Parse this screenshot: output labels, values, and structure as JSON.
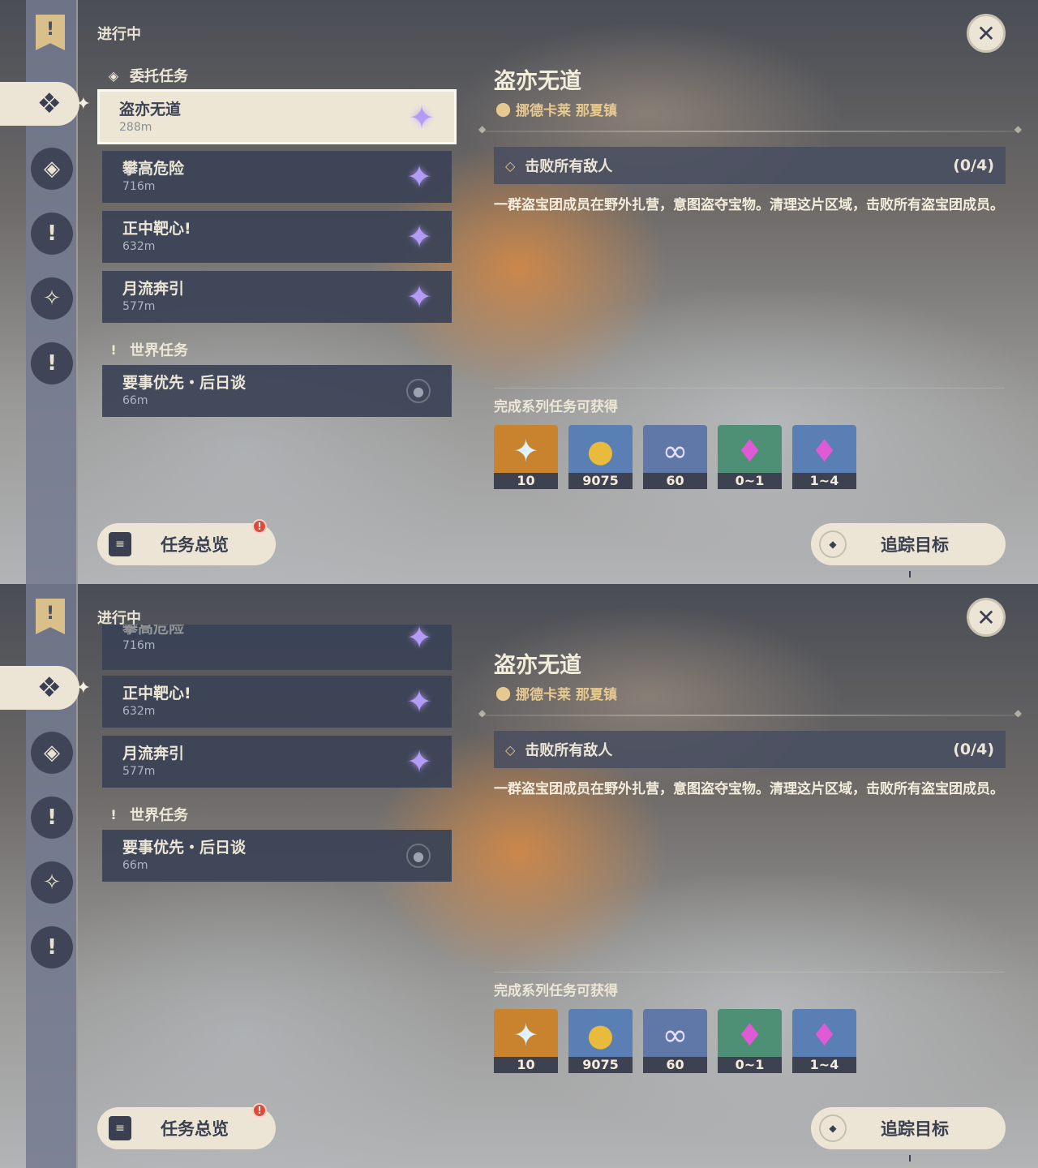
{
  "rail": {
    "banner_icon": "quest-banner-icon",
    "icons": [
      "commission-icon",
      "archon-icon",
      "story-icon",
      "world-icon",
      "exclamation-icon"
    ]
  },
  "list": {
    "status_label": "进行中",
    "sections": [
      {
        "title": "委托任务",
        "quests": [
          {
            "name": "盗亦无道",
            "distance": "288m"
          },
          {
            "name": "攀高危险",
            "distance": "716m"
          },
          {
            "name": "正中靶心!",
            "distance": "632m"
          },
          {
            "name": "月流奔引",
            "distance": "577m"
          }
        ]
      },
      {
        "title": "世界任务",
        "quests": [
          {
            "name": "要事优先・后日谈",
            "distance": "66m"
          }
        ]
      }
    ],
    "overview_button": "任务总览",
    "notify_badge": "!"
  },
  "detail": {
    "title": "盗亦无道",
    "location": "挪德卡莱 那夏镇",
    "objective": "击败所有敌人",
    "progress": "(0/4)",
    "description": "一群盗宝团成员在野外扎营，意图盗夺宝物。清理这片区域，击败所有盗宝团成员。",
    "rewards_header": "完成系列任务可获得",
    "rewards": [
      {
        "icon": "primogem-icon",
        "count": "10",
        "bg": "#c9832f"
      },
      {
        "icon": "mora-icon",
        "count": "9075",
        "bg": "#5a7fb4"
      },
      {
        "icon": "adventure-exp-icon",
        "count": "60",
        "bg": "#5f78a8"
      },
      {
        "icon": "crystal-chunk-icon",
        "count": "0~1",
        "bg": "#4d9076"
      },
      {
        "icon": "crystal-cluster-icon",
        "count": "1~4",
        "bg": "#5a7fb4"
      }
    ],
    "track_button": "追踪目标"
  },
  "colors": {
    "panel_cream": "#ece5d5",
    "card_blue": "#3a4256",
    "accent_gold": "#e6c98f",
    "star_purple": "#b39cf5"
  }
}
